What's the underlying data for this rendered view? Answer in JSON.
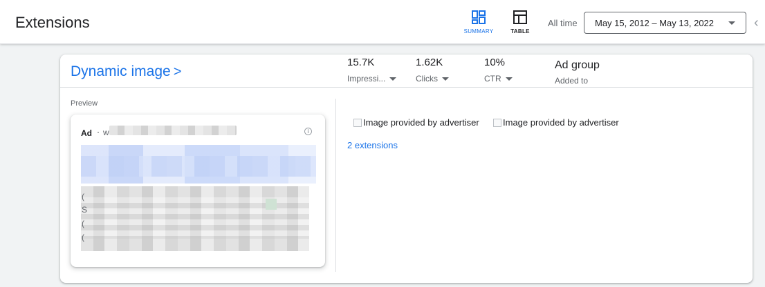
{
  "header": {
    "title": "Extensions",
    "views": [
      {
        "label": "SUMMARY",
        "icon": "summary-icon",
        "active": true
      },
      {
        "label": "TABLE",
        "icon": "table-icon",
        "active": false
      }
    ],
    "range_label": "All time",
    "date_range": "May 15, 2012 – May 13, 2022",
    "prev_icon": "chevron-left-icon"
  },
  "card": {
    "title": "Dynamic image",
    "title_chevron": ">",
    "metrics": [
      {
        "value": "15.7K",
        "label": "Impressi..."
      },
      {
        "value": "1.62K",
        "label": "Clicks"
      },
      {
        "value": "10%",
        "label": "CTR"
      }
    ],
    "level": {
      "value": "Ad group",
      "label": "Added to"
    },
    "preview_label": "Preview",
    "ad": {
      "badge": "Ad",
      "separator": "·",
      "url_start": "w",
      "info_icon": "info-icon",
      "line_starts": [
        "(",
        "S",
        "(",
        "("
      ]
    },
    "images": [
      {
        "alt": "Image provided by advertiser"
      },
      {
        "alt": "Image provided by advertiser"
      }
    ],
    "extensions_link": "2 extensions"
  },
  "colors": {
    "accent": "#1a73e8",
    "text": "#202124",
    "muted": "#5f6368",
    "background": "#f1f3f4"
  }
}
